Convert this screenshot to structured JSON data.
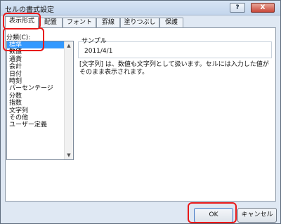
{
  "window": {
    "title": "セルの書式設定",
    "help_label": "?",
    "close_label": "X"
  },
  "tabs": [
    "表示形式",
    "配置",
    "フォント",
    "罫線",
    "塗りつぶし",
    "保護"
  ],
  "category": {
    "label": "分類(C):",
    "items": [
      "標準",
      "数値",
      "通貨",
      "会計",
      "日付",
      "時刻",
      "パーセンテージ",
      "分数",
      "指数",
      "文字列",
      "その他",
      "ユーザー定義"
    ],
    "selected_index": 0
  },
  "sample": {
    "label": "サンプル",
    "value": "2011/4/1"
  },
  "description": "[文字列] は、数値も文字列として扱います。セルには入力した値がそのまま表示されます。",
  "buttons": {
    "ok": "OK",
    "cancel": "キャンセル"
  },
  "scroll_icons": {
    "up": "▲",
    "down": "▼"
  }
}
